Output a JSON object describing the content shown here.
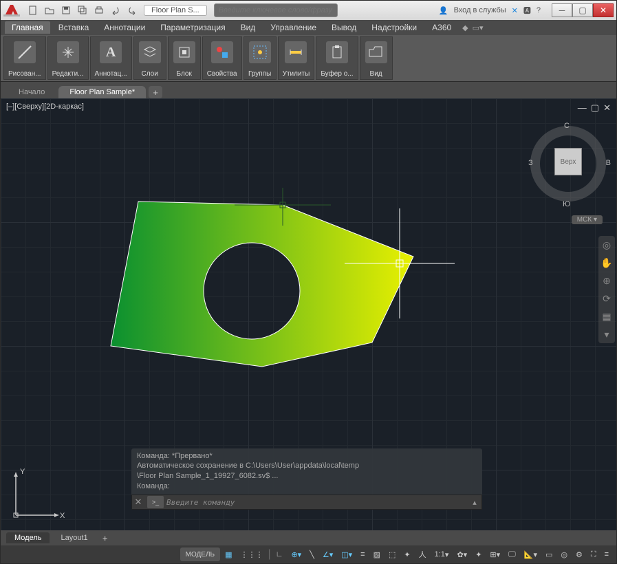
{
  "titlebar": {
    "tab_title": "Floor Plan S...",
    "search_placeholder": "Введите ключевое слово/фразу",
    "login_label": "Вход в службы"
  },
  "menu": {
    "items": [
      "Главная",
      "Вставка",
      "Аннотации",
      "Параметризация",
      "Вид",
      "Управление",
      "Вывод",
      "Надстройки",
      "A360"
    ],
    "active_index": 0
  },
  "ribbon": {
    "panels": [
      "Рисован...",
      "Редакти...",
      "Аннотац...",
      "Слои",
      "Блок",
      "Свойства",
      "Группы",
      "Утилиты",
      "Буфер о...",
      "Вид"
    ]
  },
  "filetabs": {
    "inactive": "Начало",
    "active": "Floor Plan Sample*"
  },
  "view_label": "[–][Сверху][2D-каркас]",
  "viewcube": {
    "face": "Верх",
    "n": "С",
    "s": "Ю",
    "e": "В",
    "w": "З",
    "ucs": "МСК"
  },
  "ucs_axes": {
    "x": "X",
    "y": "Y"
  },
  "cmd": {
    "history": [
      "Команда: *Прервано*",
      "Автоматическое сохранение в C:\\Users\\User\\appdata\\local\\temp",
      "\\Floor Plan Sample_1_19927_6082.sv$ ...",
      "Команда:"
    ],
    "placeholder": "Введите команду"
  },
  "layout_tabs": {
    "model": "Модель",
    "layout1": "Layout1"
  },
  "status": {
    "model": "МОДЕЛЬ",
    "scale": "1:1"
  }
}
